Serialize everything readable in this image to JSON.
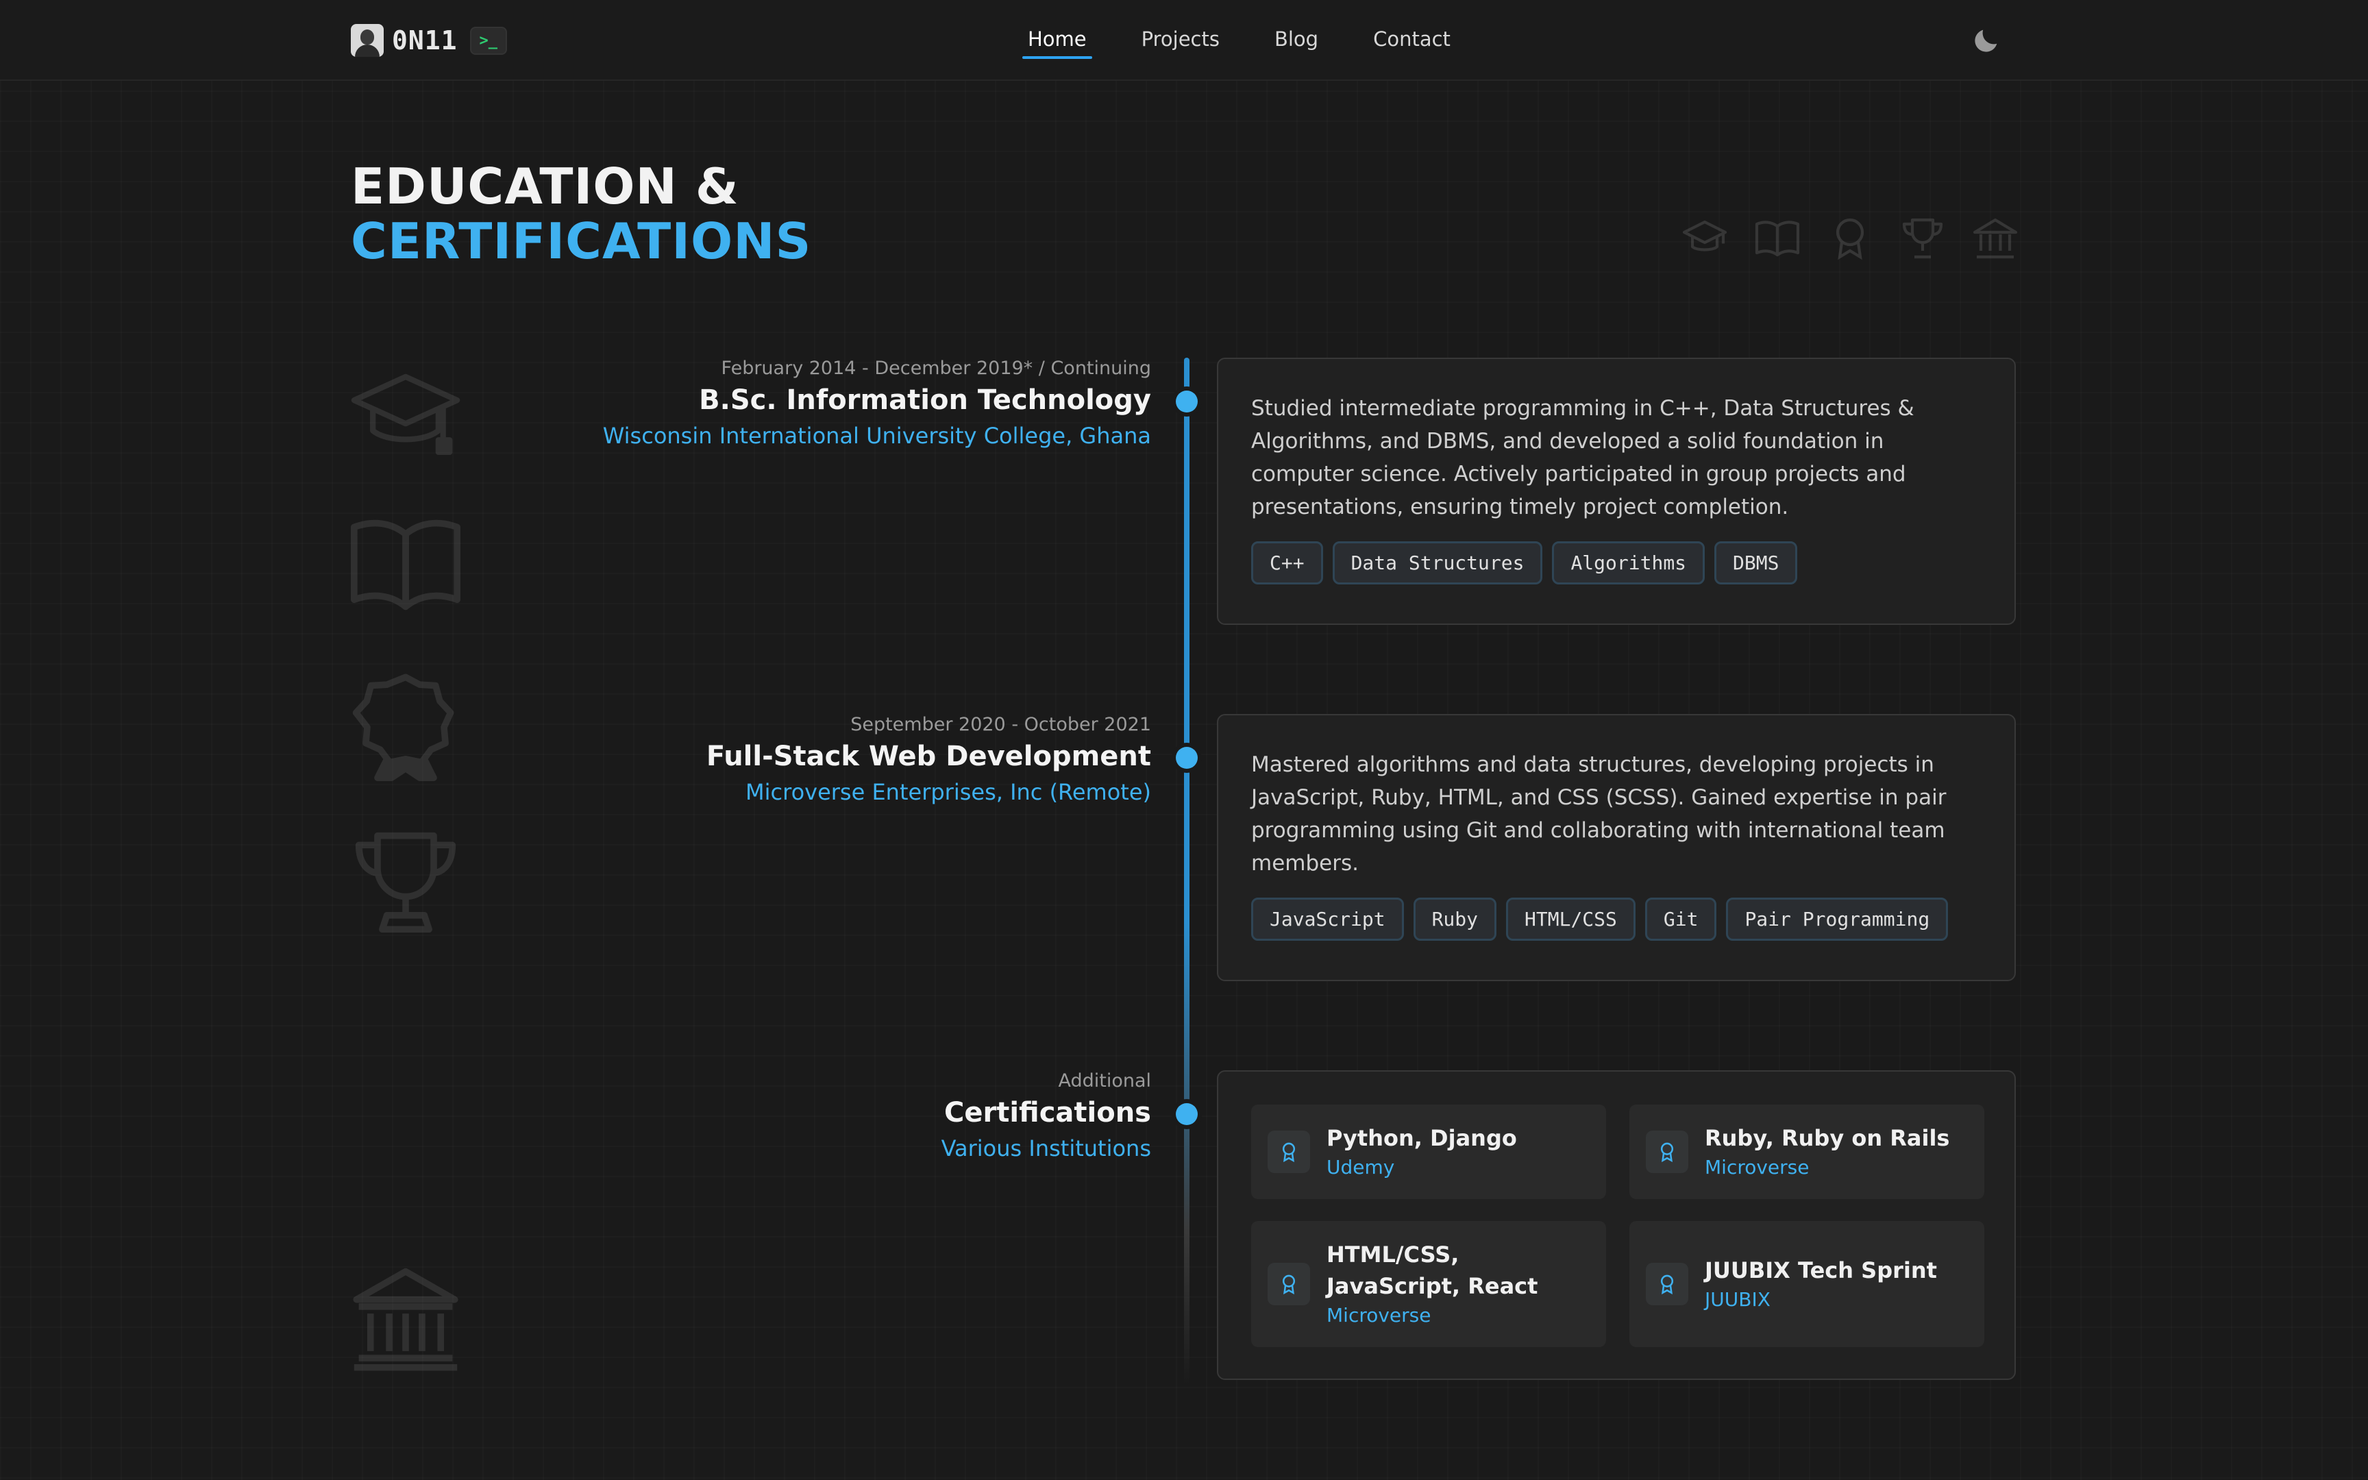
{
  "brand": {
    "name": "0N11",
    "terminal_badge": ">_"
  },
  "nav": {
    "links": [
      {
        "label": "Home",
        "active": true
      },
      {
        "label": "Projects"
      },
      {
        "label": "Blog"
      },
      {
        "label": "Contact"
      }
    ]
  },
  "heading": {
    "line1": "EDUCATION &",
    "line2": "CERTIFICATIONS"
  },
  "entries": [
    {
      "date": "February 2014 - December 2019* / Continuing",
      "title": "B.Sc. Information Technology",
      "institution": "Wisconsin International University College, Ghana",
      "description": "Studied intermediate programming in C++, Data Structures & Algorithms, and DBMS, and developed a solid foundation in computer science. Actively participated in group projects and presentations, ensuring timely project completion.",
      "tags": [
        "C++",
        "Data Structures",
        "Algorithms",
        "DBMS"
      ]
    },
    {
      "date": "September 2020 - October 2021",
      "title": "Full-Stack Web Development",
      "institution": "Microverse Enterprises, Inc (Remote)",
      "description": "Mastered algorithms and data structures, developing projects in JavaScript, Ruby, HTML, and CSS (SCSS). Gained expertise in pair programming using Git and collaborating with international team members.",
      "tags": [
        "JavaScript",
        "Ruby",
        "HTML/CSS",
        "Git",
        "Pair Programming"
      ]
    },
    {
      "date": "Additional",
      "title": "Certifications",
      "institution": "Various Institutions",
      "certifications": [
        {
          "title": "Python, Django",
          "org": "Udemy"
        },
        {
          "title": "Ruby, Ruby on Rails",
          "org": "Microverse"
        },
        {
          "title": "HTML/CSS, JavaScript, React",
          "org": "Microverse"
        },
        {
          "title": "JUUBIX Tech Sprint",
          "org": "JUUBIX"
        }
      ]
    }
  ],
  "colors": {
    "accent": "#3fb1f0",
    "background": "#1a1a1a",
    "card": "#212121",
    "terminal_green": "#2ecc71"
  },
  "icons": [
    "graduation-cap-icon",
    "book-icon",
    "award-icon",
    "trophy-icon",
    "institution-icon",
    "moon-icon",
    "certificate-icon"
  ]
}
